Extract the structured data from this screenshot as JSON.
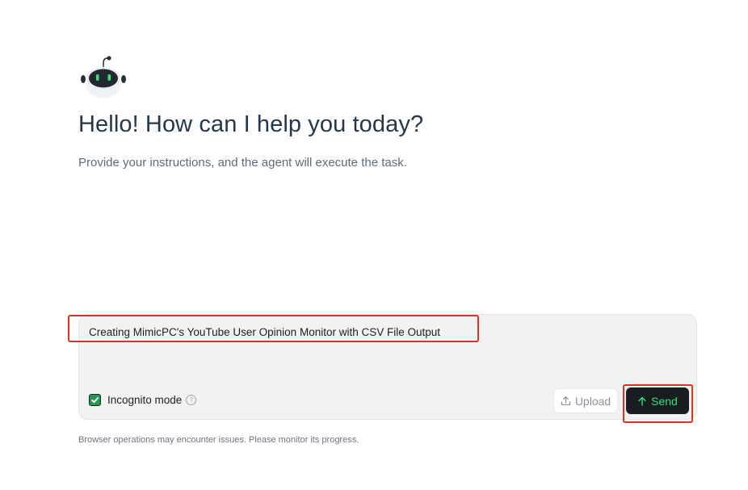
{
  "header": {
    "title": "Hello! How can I help you today?",
    "subtitle": "Provide your instructions, and the agent will execute the task."
  },
  "composer": {
    "prompt_text": "Creating MimicPC's YouTube User Opinion Monitor with CSV File Output",
    "incognito_label": "Incognito mode",
    "incognito_checked": true,
    "help_icon": "question-circle-icon",
    "upload_label": "Upload",
    "upload_icon": "upload-icon",
    "send_label": "Send",
    "send_icon": "arrow-up-icon"
  },
  "footer": {
    "note": "Browser operations may encounter issues. Please monitor its progress."
  },
  "colors": {
    "heading": "#25374a",
    "accent_green": "#2ee27a",
    "checkbox_green": "#1d9b54",
    "send_bg": "#1a1d1f",
    "highlight_red": "#e0301e"
  }
}
